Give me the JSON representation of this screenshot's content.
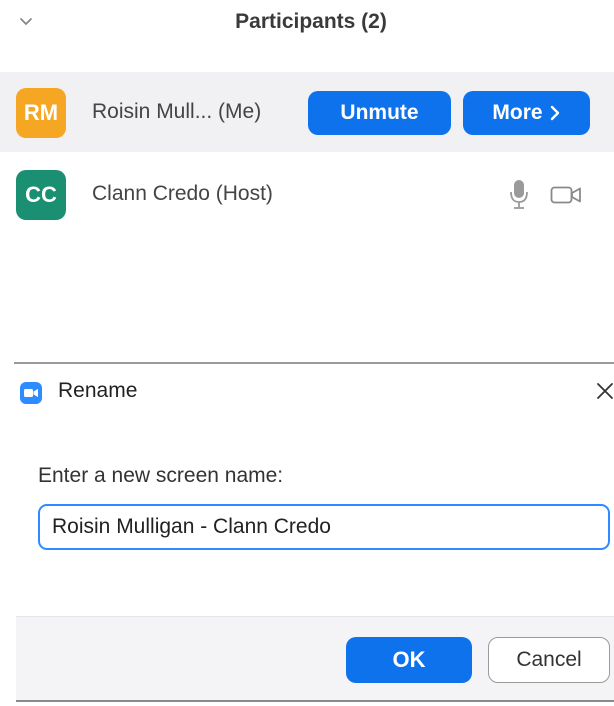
{
  "participants_panel": {
    "title": "Participants (2)",
    "collapse_icon": "chevron-down-icon",
    "participants": [
      {
        "initials": "RM",
        "name": "Roisin Mull... (Me)",
        "avatar_color": "#f5a623",
        "actions": {
          "unmute_label": "Unmute",
          "more_label": "More",
          "more_icon": "chevron-right-icon"
        }
      },
      {
        "initials": "CC",
        "name": "Clann Credo (Host)",
        "avatar_color": "#1a8f72",
        "status_icons": [
          "microphone-icon",
          "video-camera-icon"
        ]
      }
    ]
  },
  "rename_dialog": {
    "title": "Rename",
    "app_icon": "zoom-camera-icon",
    "close_icon": "close-icon",
    "prompt": "Enter a new screen name:",
    "input_value": "Roisin Mulligan - Clann Credo",
    "ok_label": "OK",
    "cancel_label": "Cancel"
  },
  "colors": {
    "accent": "#0e72ed",
    "input_focus": "#2d8cff",
    "row_highlight": "#f1f1f3",
    "footer": "#f4f4f6"
  }
}
